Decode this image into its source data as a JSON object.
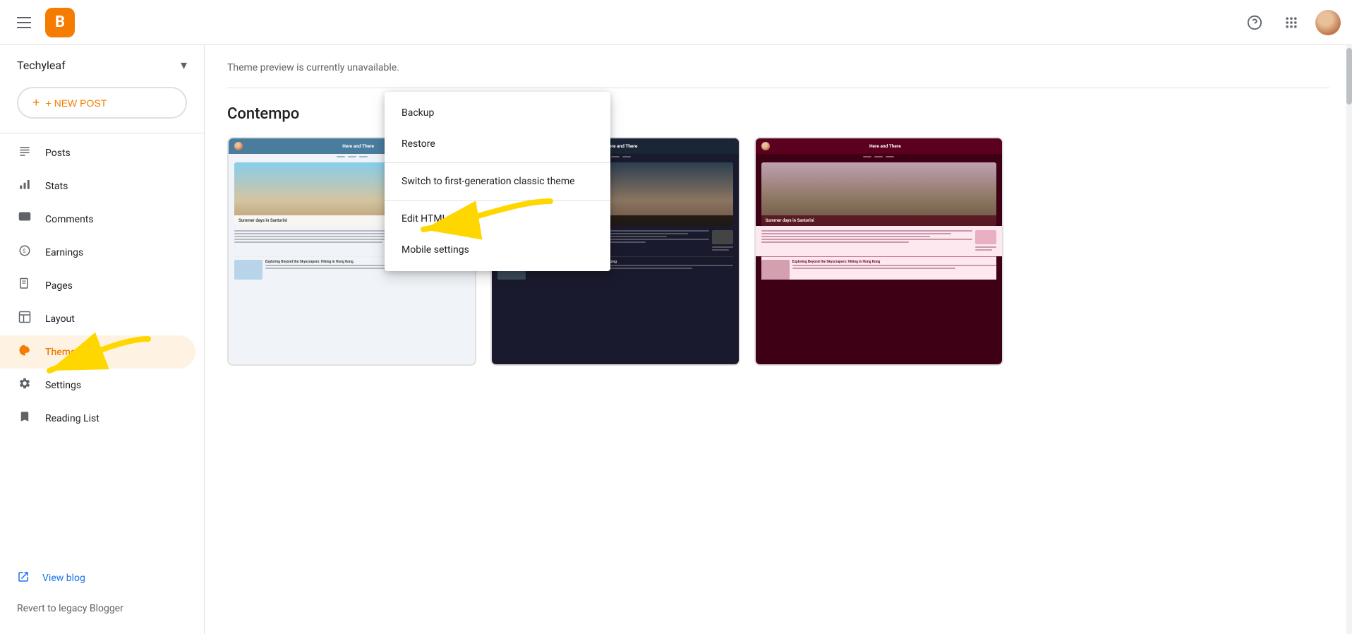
{
  "topbar": {
    "logo_letter": "B",
    "help_icon": "?",
    "grid_icon": "⋮⋮⋮"
  },
  "sidebar": {
    "blog_name": "Techyleaf",
    "new_post_label": "+ NEW POST",
    "items": [
      {
        "id": "posts",
        "icon": "☰",
        "label": "Posts"
      },
      {
        "id": "stats",
        "icon": "📊",
        "label": "Stats"
      },
      {
        "id": "comments",
        "icon": "💬",
        "label": "Comments"
      },
      {
        "id": "earnings",
        "icon": "$",
        "label": "Earnings"
      },
      {
        "id": "pages",
        "icon": "📄",
        "label": "Pages"
      },
      {
        "id": "layout",
        "icon": "⊞",
        "label": "Layout"
      },
      {
        "id": "theme",
        "icon": "🎨",
        "label": "Theme",
        "active": true
      },
      {
        "id": "settings",
        "icon": "⚙",
        "label": "Settings"
      },
      {
        "id": "reading-list",
        "icon": "🔖",
        "label": "Reading List"
      }
    ],
    "view_blog_label": "View blog",
    "revert_label": "Revert to legacy Blogger"
  },
  "main": {
    "preview_message": "Theme preview is currently unavailable.",
    "section_title": "Contempo",
    "themes": [
      {
        "id": "light",
        "variant": "light"
      },
      {
        "id": "dark",
        "variant": "dark"
      },
      {
        "id": "pink",
        "variant": "pink"
      }
    ]
  },
  "dropdown": {
    "items": [
      {
        "id": "backup",
        "label": "Backup"
      },
      {
        "id": "restore",
        "label": "Restore"
      },
      {
        "id": "switch-classic",
        "label": "Switch to first-generation classic theme"
      },
      {
        "id": "edit-html",
        "label": "Edit HTML"
      },
      {
        "id": "mobile-settings",
        "label": "Mobile settings"
      }
    ]
  },
  "mock_content": {
    "blog_title": "Here and There",
    "post_title": "Summer days in Santorini",
    "post2_title": "Exploring Beyond the Skyscrapers: Hiking in Hong Kong"
  },
  "colors": {
    "orange": "#f57c00",
    "blue": "#1a73e8",
    "active_bg": "#fef3e2"
  }
}
